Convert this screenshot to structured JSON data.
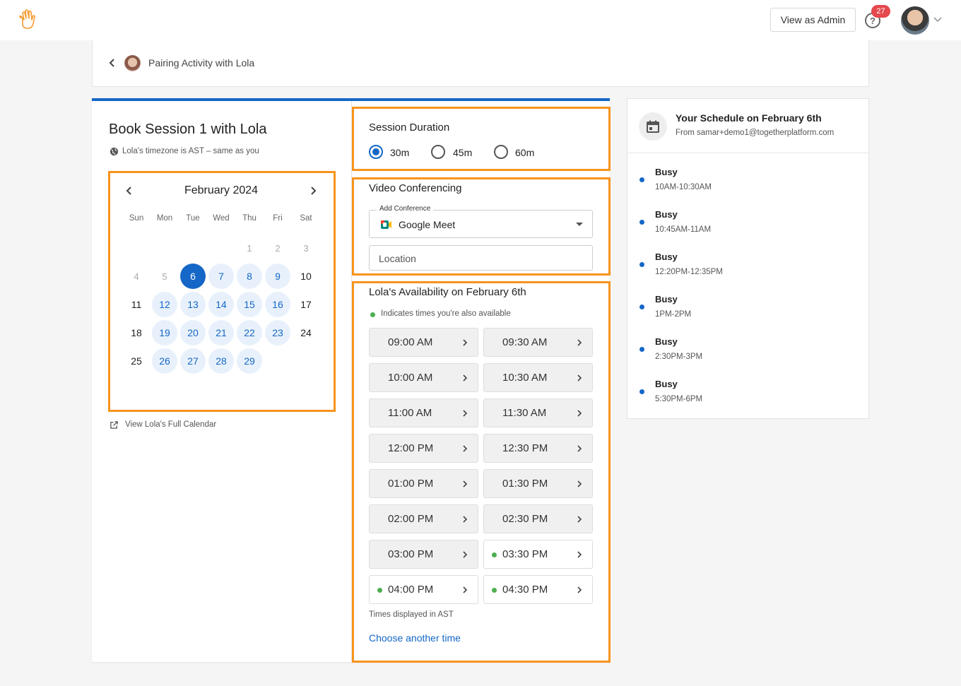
{
  "header": {
    "view_as_admin": "View as Admin",
    "help_icon_glyph": "?",
    "notification_count": "27"
  },
  "breadcrumb": {
    "title": "Pairing Activity with Lola"
  },
  "booking": {
    "title": "Book Session 1 with Lola",
    "timezone_note": "Lola's timezone is AST – same as you",
    "calendar": {
      "month_label": "February 2024",
      "weekdays": [
        "Sun",
        "Mon",
        "Tue",
        "Wed",
        "Thu",
        "Fri",
        "Sat"
      ],
      "days": [
        {
          "n": "1",
          "state": "dim"
        },
        {
          "n": "2",
          "state": "dim"
        },
        {
          "n": "3",
          "state": "dim"
        },
        {
          "n": "4",
          "state": "dim"
        },
        {
          "n": "5",
          "state": "dim"
        },
        {
          "n": "6",
          "state": "selected"
        },
        {
          "n": "7",
          "state": "available"
        },
        {
          "n": "8",
          "state": "available"
        },
        {
          "n": "9",
          "state": "available"
        },
        {
          "n": "10",
          "state": "plain"
        },
        {
          "n": "11",
          "state": "plain"
        },
        {
          "n": "12",
          "state": "available"
        },
        {
          "n": "13",
          "state": "available"
        },
        {
          "n": "14",
          "state": "available"
        },
        {
          "n": "15",
          "state": "available"
        },
        {
          "n": "16",
          "state": "available"
        },
        {
          "n": "17",
          "state": "plain"
        },
        {
          "n": "18",
          "state": "plain"
        },
        {
          "n": "19",
          "state": "available"
        },
        {
          "n": "20",
          "state": "available"
        },
        {
          "n": "21",
          "state": "available"
        },
        {
          "n": "22",
          "state": "available"
        },
        {
          "n": "23",
          "state": "available"
        },
        {
          "n": "24",
          "state": "plain"
        },
        {
          "n": "25",
          "state": "plain"
        },
        {
          "n": "26",
          "state": "available"
        },
        {
          "n": "27",
          "state": "available"
        },
        {
          "n": "28",
          "state": "available"
        },
        {
          "n": "29",
          "state": "available"
        }
      ]
    },
    "full_calendar_link": "View Lola's Full Calendar"
  },
  "session_duration": {
    "title": "Session Duration",
    "options": [
      "30m",
      "45m",
      "60m"
    ],
    "selected": "30m"
  },
  "video": {
    "title": "Video Conferencing",
    "conference_label": "Add Conference",
    "conference_value": "Google Meet",
    "location_placeholder": "Location"
  },
  "availability": {
    "title": "Lola's Availability on February 6th",
    "legend": "Indicates times you're also available",
    "slots": [
      {
        "time": "09:00 AM",
        "mutual": false
      },
      {
        "time": "09:30 AM",
        "mutual": false
      },
      {
        "time": "10:00 AM",
        "mutual": false
      },
      {
        "time": "10:30 AM",
        "mutual": false
      },
      {
        "time": "11:00 AM",
        "mutual": false
      },
      {
        "time": "11:30 AM",
        "mutual": false
      },
      {
        "time": "12:00 PM",
        "mutual": false
      },
      {
        "time": "12:30 PM",
        "mutual": false
      },
      {
        "time": "01:00 PM",
        "mutual": false
      },
      {
        "time": "01:30 PM",
        "mutual": false
      },
      {
        "time": "02:00 PM",
        "mutual": false
      },
      {
        "time": "02:30 PM",
        "mutual": false
      },
      {
        "time": "03:00 PM",
        "mutual": false
      },
      {
        "time": "03:30 PM",
        "mutual": true
      },
      {
        "time": "04:00 PM",
        "mutual": true
      },
      {
        "time": "04:30 PM",
        "mutual": true
      }
    ],
    "timezone_note": "Times displayed in AST",
    "choose_other": "Choose another time"
  },
  "schedule": {
    "title": "Your Schedule on February 6th",
    "from": "From samar+demo1@togetherplatform.com",
    "events": [
      {
        "label": "Busy",
        "time": "10AM-10:30AM"
      },
      {
        "label": "Busy",
        "time": "10:45AM-11AM"
      },
      {
        "label": "Busy",
        "time": "12:20PM-12:35PM"
      },
      {
        "label": "Busy",
        "time": "1PM-2PM"
      },
      {
        "label": "Busy",
        "time": "2:30PM-3PM"
      },
      {
        "label": "Busy",
        "time": "5:30PM-6PM"
      }
    ]
  },
  "colors": {
    "accent": "#1467c6",
    "highlight": "#f7941d",
    "available_dot": "#4caf50",
    "badge": "#e5484d"
  }
}
